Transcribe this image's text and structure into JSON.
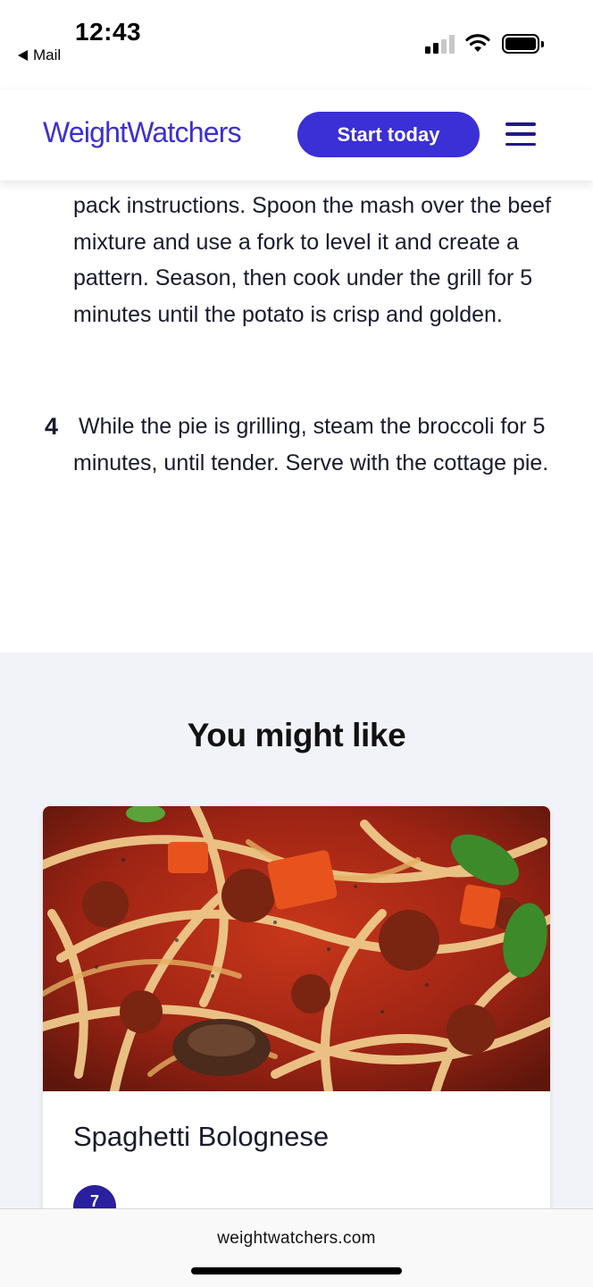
{
  "status_bar": {
    "time": "12:43",
    "back_label": "Mail",
    "icons": [
      "cellular-signal-icon",
      "wifi-icon",
      "battery-icon"
    ]
  },
  "header": {
    "logo_text": "WeightWatchers",
    "cta_label": "Start today",
    "menu_icon": "hamburger-menu-icon",
    "brand_color": "#3b2fd6"
  },
  "steps": {
    "step_3_partial": "pack instructions. Spoon the mash over the beef mixture and use a fork to level it and create a pattern. Season, then cook under the grill for 5 minutes until the potato is crisp and golden.",
    "step_4": {
      "number": "4",
      "text": "While the pie is grilling, steam the broccoli for 5 minutes, until tender. Serve with the cottage pie."
    }
  },
  "recommendations": {
    "heading": "You might like",
    "cards": [
      {
        "title": "Spaghetti Bolognese",
        "image_icon": "spaghetti-bolognese-photo",
        "points": "7"
      }
    ]
  },
  "browser": {
    "url": "weightwatchers.com"
  }
}
